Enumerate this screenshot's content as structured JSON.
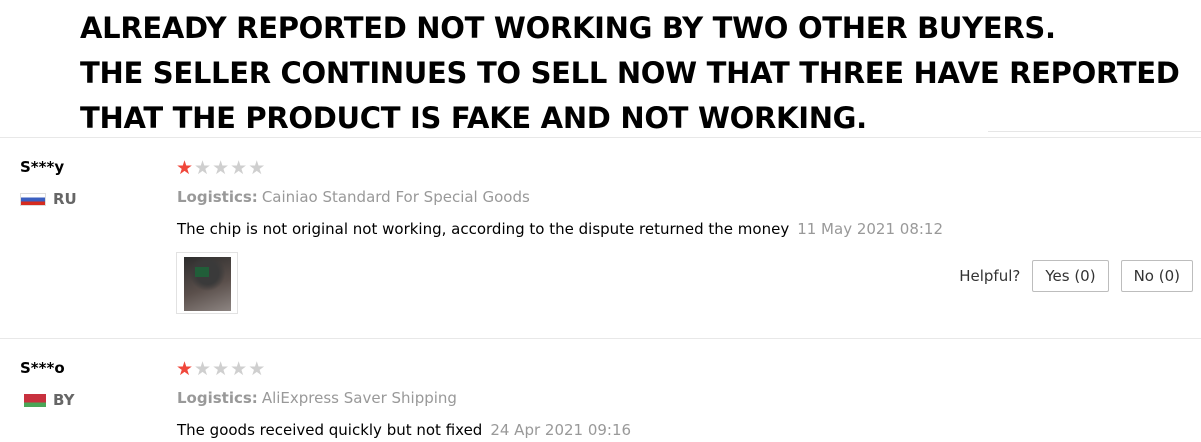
{
  "banner": {
    "lines": [
      "ALREADY REPORTED NOT WORKING BY TWO OTHER BUYERS.",
      "THE SELLER CONTINUES TO SELL NOW THAT THREE HAVE REPORTED",
      "THAT THE PRODUCT IS FAKE AND NOT WORKING."
    ]
  },
  "reviews": [
    {
      "user": "S***y",
      "country_code": "RU",
      "rating": 1,
      "rating_max": 5,
      "logistics_label": "Logistics:",
      "logistics_value": "Cainiao Standard For Special Goods",
      "text": "The chip is not original not working, according to the dispute returned the money",
      "date": "11 May 2021 08:12",
      "has_photo": true,
      "helpful_label": "Helpful?",
      "yes_label": "Yes (0)",
      "no_label": "No (0)"
    },
    {
      "user": "S***o",
      "country_code": "BY",
      "rating": 1,
      "rating_max": 5,
      "logistics_label": "Logistics:",
      "logistics_value": "AliExpress Saver Shipping",
      "text": "The goods received quickly but not fixed",
      "date": "24 Apr 2021 09:16"
    }
  ],
  "colors": {
    "star_filled": "#f0473b",
    "star_empty": "#cfcfcf",
    "muted_text": "#999999"
  }
}
